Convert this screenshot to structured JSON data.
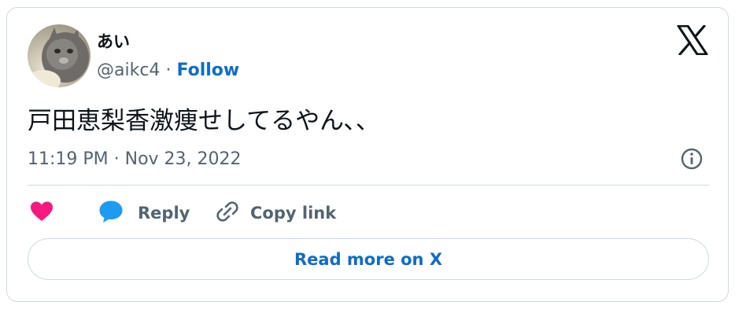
{
  "author": {
    "display_name": "あい",
    "handle": "@aikc4",
    "separator": "·",
    "follow_label": "Follow"
  },
  "tweet": {
    "text": "戸田恵梨香激痩せしてるやん､､",
    "timestamp": "11:19 PM · Nov 23, 2022"
  },
  "actions": {
    "reply_label": "Reply",
    "copy_label": "Copy link"
  },
  "read_more_label": "Read more on X",
  "icons": {
    "logo": "x-logo",
    "info": "info-icon",
    "like": "heart-icon",
    "reply": "speech-bubble-icon",
    "copy": "link-icon"
  },
  "colors": {
    "link": "#0f6cc9",
    "heart": "#f91880",
    "reply_bubble": "#1d9bf0",
    "muted_text": "#536471",
    "border": "#cfd9de"
  }
}
